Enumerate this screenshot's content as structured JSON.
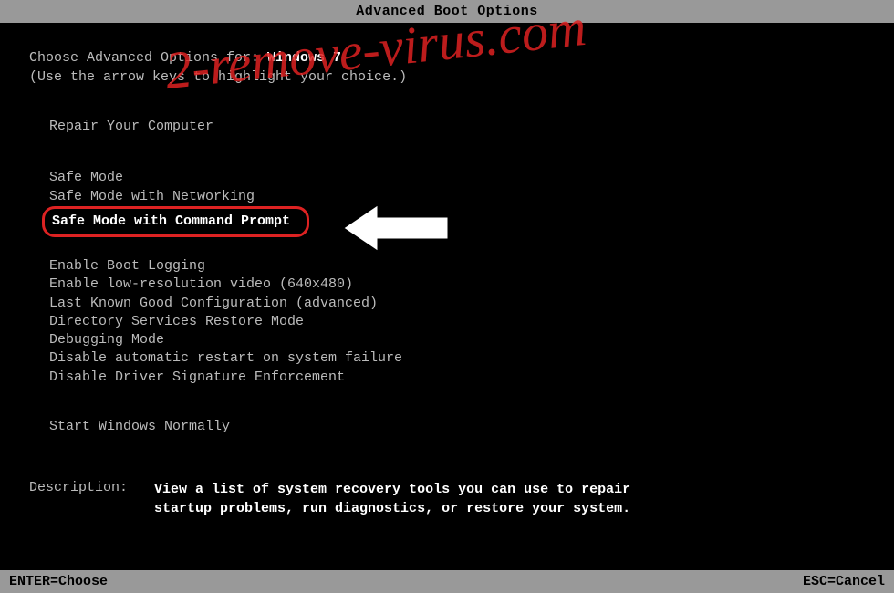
{
  "title": "Advanced Boot Options",
  "prompt_prefix": "Choose Advanced Options for: ",
  "os_name": "Windows 7",
  "hint": "(Use the arrow keys to highlight your choice.)",
  "repair_label": "Repair Your Computer",
  "menu": {
    "safe_mode": "Safe Mode",
    "safe_mode_net": "Safe Mode with Networking",
    "safe_mode_cmd": "Safe Mode with Command Prompt",
    "boot_logging": "Enable Boot Logging",
    "low_res": "Enable low-resolution video (640x480)",
    "last_known": "Last Known Good Configuration (advanced)",
    "ds_restore": "Directory Services Restore Mode",
    "debug": "Debugging Mode",
    "disable_restart": "Disable automatic restart on system failure",
    "disable_driver_sig": "Disable Driver Signature Enforcement",
    "start_normal": "Start Windows Normally"
  },
  "description_label": "Description:",
  "description_text": "View a list of system recovery tools you can use to repair startup problems, run diagnostics, or restore your system.",
  "footer": {
    "enter": "ENTER=Choose",
    "esc": "ESC=Cancel"
  },
  "watermark": "2-remove-virus.com",
  "colors": {
    "highlight_border": "#d22",
    "watermark": "#d22",
    "bar_bg": "#999"
  }
}
